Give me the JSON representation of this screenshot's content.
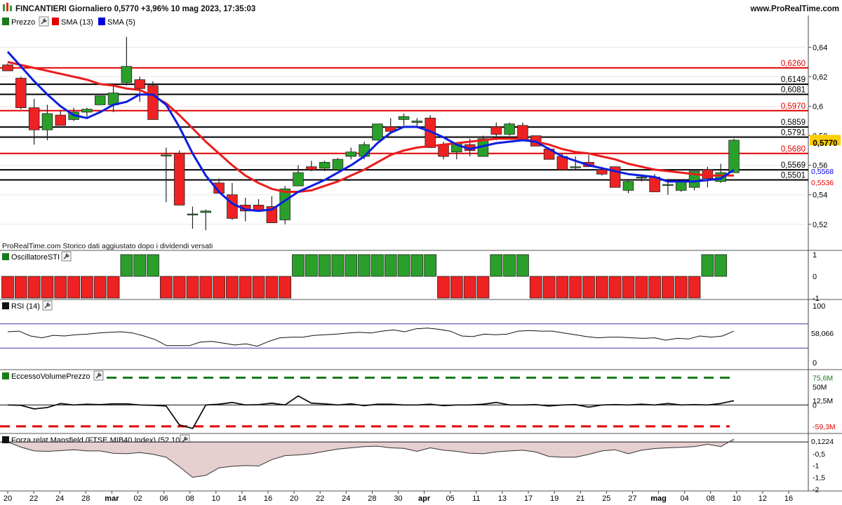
{
  "header": {
    "title": "FINCANTIERI Giornaliero 0,5770 +3,96% 10 mag 2023, 17:35:03",
    "site": "www.ProRealTime.com"
  },
  "price_panel": {
    "legend": [
      {
        "label": "Prezzo",
        "color": "#1a7a1a",
        "icon": "wrench-icon"
      },
      {
        "label": "SMA (13)",
        "color": "#e00000"
      },
      {
        "label": "SMA (5)",
        "color": "#0000dd"
      }
    ],
    "footnote": "ProRealTime.com  Storico dati aggiustato dopo i dividendi versati",
    "last_price_label": "0,5770",
    "sma5_label": "0,5568",
    "sma13_label": "0,5536"
  },
  "colors": {
    "up": "#2aa02a",
    "down": "#ee2222",
    "sma5": "#0a1ee0",
    "sma13": "#ea1c1c",
    "grid": "#e8e8e8",
    "price_box": "#ffcc00"
  },
  "chart_data": [
    {
      "type": "candlestick",
      "title": "FINCANTIERI Giornaliero",
      "x_ticks": [
        "20",
        "22",
        "24",
        "28",
        "mar",
        "02",
        "06",
        "08",
        "10",
        "14",
        "16",
        "20",
        "22",
        "24",
        "28",
        "30",
        "apr",
        "05",
        "11",
        "13",
        "17",
        "19",
        "21",
        "25",
        "27",
        "mag",
        "04",
        "08",
        "10",
        "12",
        "16"
      ],
      "y_ticks": [
        "0,64",
        "0,62",
        "0,6",
        "0,58",
        "0,56",
        "0,54",
        "0,52"
      ],
      "ylim": [
        0.508,
        0.653
      ],
      "candles": [
        {
          "o": 0.628,
          "h": 0.629,
          "l": 0.624,
          "c": 0.624
        },
        {
          "o": 0.619,
          "h": 0.62,
          "l": 0.598,
          "c": 0.599
        },
        {
          "o": 0.599,
          "h": 0.605,
          "l": 0.574,
          "c": 0.584
        },
        {
          "o": 0.584,
          "h": 0.601,
          "l": 0.577,
          "c": 0.595
        },
        {
          "o": 0.594,
          "h": 0.597,
          "l": 0.587,
          "c": 0.587
        },
        {
          "o": 0.591,
          "h": 0.599,
          "l": 0.59,
          "c": 0.596
        },
        {
          "o": 0.596,
          "h": 0.599,
          "l": 0.593,
          "c": 0.598
        },
        {
          "o": 0.601,
          "h": 0.607,
          "l": 0.601,
          "c": 0.607
        },
        {
          "o": 0.601,
          "h": 0.614,
          "l": 0.596,
          "c": 0.609
        },
        {
          "o": 0.616,
          "h": 0.647,
          "l": 0.614,
          "c": 0.627
        },
        {
          "o": 0.618,
          "h": 0.62,
          "l": 0.603,
          "c": 0.612
        },
        {
          "o": 0.614,
          "h": 0.617,
          "l": 0.591,
          "c": 0.591
        },
        {
          "o": 0.567,
          "h": 0.572,
          "l": 0.535,
          "c": 0.567
        },
        {
          "o": 0.568,
          "h": 0.57,
          "l": 0.538,
          "c": 0.533
        },
        {
          "o": 0.527,
          "h": 0.532,
          "l": 0.517,
          "c": 0.527
        },
        {
          "o": 0.528,
          "h": 0.53,
          "l": 0.516,
          "c": 0.529
        },
        {
          "o": 0.548,
          "h": 0.551,
          "l": 0.541,
          "c": 0.541
        },
        {
          "o": 0.54,
          "h": 0.548,
          "l": 0.523,
          "c": 0.524
        },
        {
          "o": 0.533,
          "h": 0.538,
          "l": 0.522,
          "c": 0.529
        },
        {
          "o": 0.533,
          "h": 0.537,
          "l": 0.529,
          "c": 0.529
        },
        {
          "o": 0.532,
          "h": 0.539,
          "l": 0.521,
          "c": 0.521
        },
        {
          "o": 0.523,
          "h": 0.546,
          "l": 0.52,
          "c": 0.544
        },
        {
          "o": 0.546,
          "h": 0.56,
          "l": 0.546,
          "c": 0.555
        },
        {
          "o": 0.559,
          "h": 0.563,
          "l": 0.556,
          "c": 0.557
        },
        {
          "o": 0.558,
          "h": 0.563,
          "l": 0.556,
          "c": 0.562
        },
        {
          "o": 0.557,
          "h": 0.565,
          "l": 0.557,
          "c": 0.564
        },
        {
          "o": 0.566,
          "h": 0.572,
          "l": 0.564,
          "c": 0.569
        },
        {
          "o": 0.566,
          "h": 0.576,
          "l": 0.564,
          "c": 0.574
        },
        {
          "o": 0.577,
          "h": 0.587,
          "l": 0.577,
          "c": 0.588
        },
        {
          "o": 0.586,
          "h": 0.592,
          "l": 0.583,
          "c": 0.583
        },
        {
          "o": 0.591,
          "h": 0.595,
          "l": 0.587,
          "c": 0.593
        },
        {
          "o": 0.589,
          "h": 0.592,
          "l": 0.586,
          "c": 0.59
        },
        {
          "o": 0.592,
          "h": 0.594,
          "l": 0.572,
          "c": 0.572
        },
        {
          "o": 0.574,
          "h": 0.576,
          "l": 0.564,
          "c": 0.566
        },
        {
          "o": 0.569,
          "h": 0.575,
          "l": 0.564,
          "c": 0.575
        },
        {
          "o": 0.574,
          "h": 0.578,
          "l": 0.566,
          "c": 0.57
        },
        {
          "o": 0.566,
          "h": 0.58,
          "l": 0.566,
          "c": 0.578
        },
        {
          "o": 0.586,
          "h": 0.589,
          "l": 0.577,
          "c": 0.581
        },
        {
          "o": 0.581,
          "h": 0.589,
          "l": 0.58,
          "c": 0.588
        },
        {
          "o": 0.587,
          "h": 0.589,
          "l": 0.578,
          "c": 0.578
        },
        {
          "o": 0.58,
          "h": 0.58,
          "l": 0.573,
          "c": 0.573
        },
        {
          "o": 0.571,
          "h": 0.572,
          "l": 0.564,
          "c": 0.564
        },
        {
          "o": 0.566,
          "h": 0.568,
          "l": 0.557,
          "c": 0.557
        },
        {
          "o": 0.559,
          "h": 0.566,
          "l": 0.557,
          "c": 0.559
        },
        {
          "o": 0.562,
          "h": 0.567,
          "l": 0.559,
          "c": 0.559
        },
        {
          "o": 0.557,
          "h": 0.559,
          "l": 0.553,
          "c": 0.554
        },
        {
          "o": 0.559,
          "h": 0.559,
          "l": 0.545,
          "c": 0.545
        },
        {
          "o": 0.543,
          "h": 0.55,
          "l": 0.541,
          "c": 0.549
        },
        {
          "o": 0.552,
          "h": 0.554,
          "l": 0.549,
          "c": 0.552
        },
        {
          "o": 0.552,
          "h": 0.554,
          "l": 0.542,
          "c": 0.542
        },
        {
          "o": 0.547,
          "h": 0.55,
          "l": 0.54,
          "c": 0.547
        },
        {
          "o": 0.543,
          "h": 0.55,
          "l": 0.542,
          "c": 0.549
        },
        {
          "o": 0.545,
          "h": 0.556,
          "l": 0.543,
          "c": 0.556
        },
        {
          "o": 0.557,
          "h": 0.559,
          "l": 0.545,
          "c": 0.551
        },
        {
          "o": 0.549,
          "h": 0.561,
          "l": 0.548,
          "c": 0.555
        },
        {
          "o": 0.555,
          "h": 0.578,
          "l": 0.555,
          "c": 0.577
        }
      ],
      "sma5": [
        0.637,
        0.627,
        0.617,
        0.608,
        0.6,
        0.594,
        0.592,
        0.596,
        0.601,
        0.603,
        0.608,
        0.608,
        0.601,
        0.586,
        0.568,
        0.553,
        0.542,
        0.534,
        0.53,
        0.529,
        0.53,
        0.536,
        0.542,
        0.546,
        0.55,
        0.555,
        0.56,
        0.566,
        0.575,
        0.582,
        0.586,
        0.586,
        0.583,
        0.579,
        0.574,
        0.571,
        0.573,
        0.575,
        0.576,
        0.577,
        0.576,
        0.571,
        0.566,
        0.563,
        0.56,
        0.558,
        0.556,
        0.554,
        0.553,
        0.552,
        0.549,
        0.549,
        0.549,
        0.55,
        0.551,
        0.557
      ],
      "sma13": [
        0.63,
        0.628,
        0.626,
        0.624,
        0.622,
        0.62,
        0.618,
        0.615,
        0.614,
        0.612,
        0.611,
        0.607,
        0.602,
        0.594,
        0.585,
        0.576,
        0.568,
        0.56,
        0.553,
        0.548,
        0.544,
        0.542,
        0.542,
        0.543,
        0.546,
        0.549,
        0.553,
        0.557,
        0.562,
        0.567,
        0.57,
        0.572,
        0.573,
        0.574,
        0.575,
        0.576,
        0.577,
        0.578,
        0.578,
        0.578,
        0.576,
        0.574,
        0.571,
        0.569,
        0.568,
        0.566,
        0.564,
        0.561,
        0.559,
        0.557,
        0.556,
        0.555,
        0.554,
        0.553,
        0.553,
        0.553
      ],
      "levels": [
        {
          "value": 0.626,
          "label": "0,6260",
          "color": "#e00000"
        },
        {
          "value": 0.6149,
          "label": "0,6149",
          "color": "#000000"
        },
        {
          "value": 0.6081,
          "label": "0,6081",
          "color": "#000000"
        },
        {
          "value": 0.597,
          "label": "0,5970",
          "color": "#e00000"
        },
        {
          "value": 0.5859,
          "label": "0,5859",
          "color": "#000000"
        },
        {
          "value": 0.5791,
          "label": "0,5791",
          "color": "#000000"
        },
        {
          "value": 0.568,
          "label": "0,5680",
          "color": "#e00000"
        },
        {
          "value": 0.5569,
          "label": "0,5569",
          "color": "#000000"
        },
        {
          "value": 0.5501,
          "label": "0,5501",
          "color": "#000000"
        }
      ]
    },
    {
      "type": "bar",
      "title": "OscillatoreSTI",
      "y_ticks": [
        "1",
        "0",
        "-1"
      ],
      "ylim": [
        -1.1,
        1.1
      ],
      "values": [
        -1,
        -1,
        -1,
        -1,
        -1,
        -1,
        -1,
        -1,
        -1,
        1,
        1,
        1,
        -1,
        -1,
        -1,
        -1,
        -1,
        -1,
        -1,
        -1,
        -1,
        -1,
        1,
        1,
        1,
        1,
        1,
        1,
        1,
        1,
        1,
        1,
        1,
        -1,
        -1,
        -1,
        -1,
        1,
        1,
        1,
        -1,
        -1,
        -1,
        -1,
        -1,
        -1,
        -1,
        -1,
        -1,
        -1,
        -1,
        -1,
        -1,
        1,
        1
      ]
    },
    {
      "type": "line",
      "title": "RSI (14)",
      "y_ticks": [
        "100",
        "0"
      ],
      "ylim": [
        0,
        100
      ],
      "last_label": "58,066",
      "bands": [
        70,
        30
      ],
      "values": [
        57,
        58,
        50,
        47,
        51,
        50,
        52,
        53,
        55,
        56,
        57,
        55,
        50,
        44,
        34,
        34,
        34,
        40,
        41,
        38,
        35,
        37,
        33,
        41,
        47,
        48,
        48,
        51,
        52,
        53,
        55,
        56,
        55,
        58,
        60,
        57,
        62,
        63,
        61,
        58,
        50,
        49,
        53,
        52,
        53,
        58,
        59,
        58,
        58,
        55,
        52,
        49,
        47,
        48,
        48,
        47,
        46,
        47,
        43,
        46,
        45,
        50,
        48,
        50,
        58
      ]
    },
    {
      "type": "line",
      "title": "EccessoVolumePrezzo",
      "y_ticks": [
        "75,6M",
        "50M",
        "12,5M",
        "0",
        "-59,3M"
      ],
      "ylim": [
        -75,
        92
      ],
      "upper_label": "75,6M",
      "lower_label": "-59,3M",
      "upper_value": 75.6,
      "lower_value": -59.3,
      "values": [
        0,
        -1,
        -11,
        -7,
        4,
        0,
        2,
        1,
        3,
        3,
        0,
        -1,
        -3,
        -55,
        -65,
        0,
        2,
        7,
        0,
        1,
        5,
        0,
        25,
        5,
        3,
        0,
        3,
        -2,
        2,
        2,
        0,
        0,
        2,
        -2,
        0,
        0,
        2,
        7,
        0,
        0,
        1,
        -3,
        0,
        1,
        -6,
        0,
        1,
        0,
        2,
        0,
        4,
        0,
        1,
        0,
        4,
        12
      ]
    },
    {
      "type": "area",
      "title": "Forza relat Mansfield (FTSE MIB40 Index) (52 10)",
      "y_ticks": [
        "-0,5",
        "-1",
        "-1,5",
        "-2"
      ],
      "ylim": [
        -2.05,
        0.3
      ],
      "last_label": "0,1224",
      "values": [
        0,
        -0.22,
        -0.38,
        -0.4,
        -0.37,
        -0.33,
        -0.38,
        -0.38,
        -0.48,
        -0.5,
        -0.45,
        -0.52,
        -0.65,
        -1.05,
        -1.5,
        -1.42,
        -1.1,
        -1.03,
        -1.0,
        -1.02,
        -0.75,
        -0.58,
        -0.55,
        -0.5,
        -0.4,
        -0.3,
        -0.25,
        -0.2,
        -0.18,
        -0.25,
        -0.27,
        -0.4,
        -0.25,
        -0.35,
        -0.4,
        -0.48,
        -0.5,
        -0.42,
        -0.38,
        -0.35,
        -0.43,
        -0.62,
        -0.65,
        -0.65,
        -0.53,
        -0.38,
        -0.33,
        -0.5,
        -0.35,
        -0.28,
        -0.25,
        -0.23,
        -0.2,
        -0.1,
        -0.2,
        0.12
      ]
    }
  ]
}
